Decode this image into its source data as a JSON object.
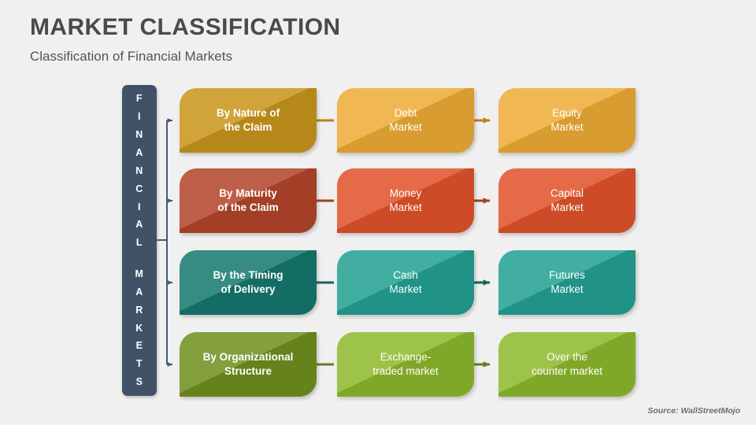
{
  "header": {
    "title": "MARKET CLASSIFICATION",
    "subtitle": "Classification of Financial Markets"
  },
  "root": {
    "label": "FINANCIAL MARKETS",
    "letters": [
      "F",
      "I",
      "N",
      "A",
      "N",
      "C",
      "I",
      "A",
      "L",
      "",
      "M",
      "A",
      "R",
      "K",
      "E",
      "T",
      "S"
    ],
    "color": "#415268"
  },
  "rows": [
    {
      "category": "By Nature of\nthe Claim",
      "category_line1": "By Nature of",
      "category_line2": "the Claim",
      "items": [
        {
          "line1": "Debt",
          "line2": "Market"
        },
        {
          "line1": "Equity",
          "line2": "Market"
        }
      ],
      "color_dark": "#c8941b",
      "color_light": "#eeab35",
      "connector_color": "#b88212"
    },
    {
      "category": "By Maturity\nof the Claim",
      "category_line1": "By Maturity",
      "category_line2": "of the Claim",
      "items": [
        {
          "line1": "Money",
          "line2": "Market"
        },
        {
          "line1": "Capital",
          "line2": "Market"
        }
      ],
      "color_dark": "#b2452a",
      "color_light": "#e1522a",
      "connector_color": "#a53f22"
    },
    {
      "category": "By the Timing\nof Delivery",
      "category_line1": "By the Timing",
      "category_line2": "of Delivery",
      "items": [
        {
          "line1": "Cash",
          "line2": "Market"
        },
        {
          "line1": "Futures",
          "line2": "Market"
        }
      ],
      "color_dark": "#15786e",
      "color_light": "#23a193",
      "connector_color": "#11655d"
    },
    {
      "category": "By Organizational\nStructure",
      "category_line1": "By Organizational",
      "category_line2": "Structure",
      "items": [
        {
          "line1": "Exchange-",
          "line2": "traded market"
        },
        {
          "line1": "Over the",
          "line2": "counter market"
        }
      ],
      "color_dark": "#6f8f1e",
      "color_light": "#8db92c",
      "connector_color": "#63801b"
    }
  ],
  "source": "Source: WallStreetMojo",
  "theme": {
    "background": "#f0f0f0",
    "title_color": "#4a4a4a",
    "subtitle_color": "#545454",
    "bracket_color": "#46597a"
  }
}
